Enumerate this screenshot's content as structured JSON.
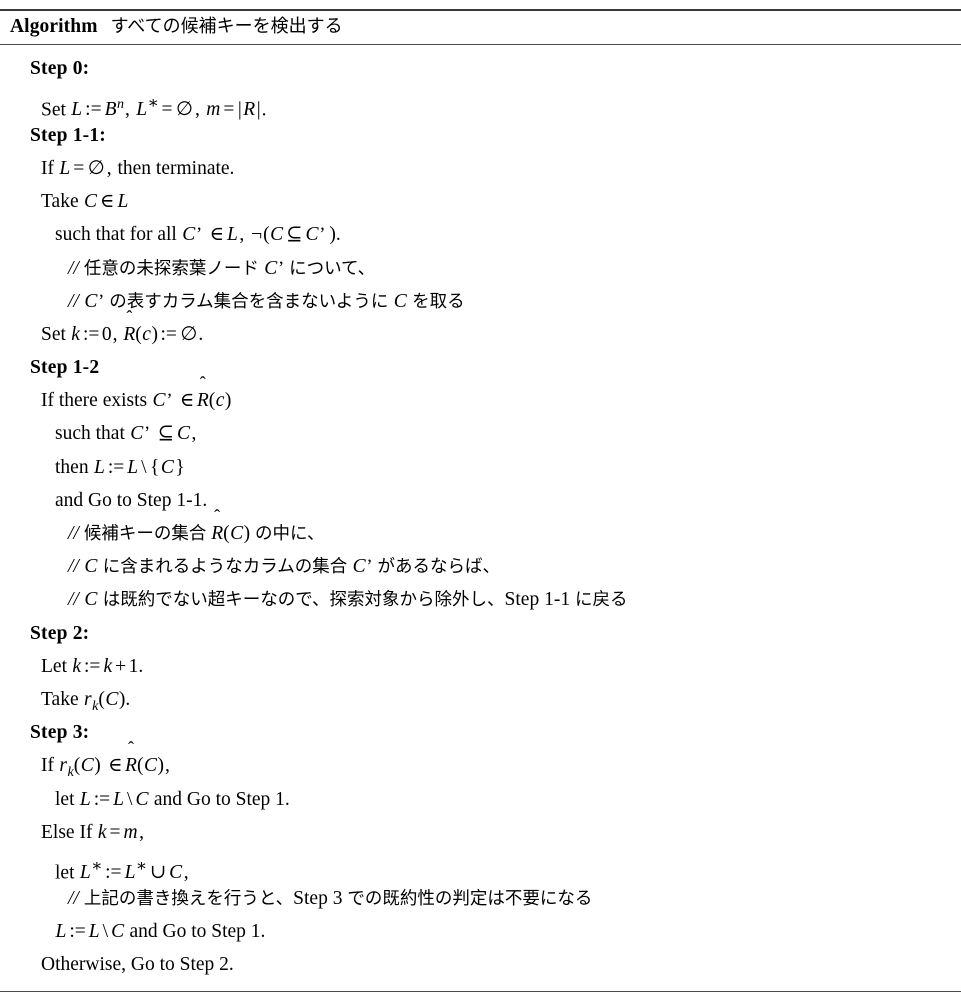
{
  "algorithm": {
    "caption_keyword": "Algorithm",
    "caption_title": "すべての候補キーを検出する",
    "steps": [
      {
        "heading": "Step 0:",
        "lines": [
          {
            "indent": 1,
            "kind": "math",
            "text": "Set L := Bⁿ, L* = ∅, m = |R|."
          }
        ]
      },
      {
        "heading": "Step 1-1:",
        "lines": [
          {
            "indent": 1,
            "kind": "math",
            "text": "If L = ∅, then terminate."
          },
          {
            "indent": 1,
            "kind": "math",
            "text": "Take C ∈ L"
          },
          {
            "indent": 2,
            "kind": "math",
            "text": "such that for all C’ ∈ L, ¬(C ⊆ C’)."
          },
          {
            "indent": 3,
            "kind": "comment",
            "text": "// 任意の未探索葉ノード C’ について、"
          },
          {
            "indent": 3,
            "kind": "comment",
            "text": "// C’ の表すカラム集合を含まないように C を取る"
          },
          {
            "indent": 1,
            "kind": "math",
            "text": "Set k := 0, R̂(c) := ∅."
          }
        ]
      },
      {
        "heading": "Step 1-2",
        "lines": [
          {
            "indent": 1,
            "kind": "math",
            "text": "If there exists C’ ∈ R̂(c)"
          },
          {
            "indent": 2,
            "kind": "math",
            "text": "such that C’ ⊆ C,"
          },
          {
            "indent": 2,
            "kind": "math",
            "text": "then L := L \\ {C}"
          },
          {
            "indent": 2,
            "kind": "math",
            "text": "and Go to Step 1-1."
          },
          {
            "indent": 3,
            "kind": "comment",
            "text": "// 候補キーの集合 R̂(C) の中に、"
          },
          {
            "indent": 3,
            "kind": "comment",
            "text": "// C に含まれるようなカラムの集合 C’ があるならば、"
          },
          {
            "indent": 3,
            "kind": "comment",
            "text": "// C は既約でない超キーなので、探索対象から除外し、Step 1-1 に戻る"
          }
        ]
      },
      {
        "heading": "Step 2:",
        "lines": [
          {
            "indent": 1,
            "kind": "math",
            "text": "Let k := k + 1."
          },
          {
            "indent": 1,
            "kind": "math",
            "text": "Take rₖ(C)."
          }
        ]
      },
      {
        "heading": "Step 3:",
        "lines": [
          {
            "indent": 1,
            "kind": "math",
            "text": "If rₖ(C) ∈ R̂(C),"
          },
          {
            "indent": 2,
            "kind": "math",
            "text": "let L := L \\ C and Go to Step 1."
          },
          {
            "indent": 1,
            "kind": "math",
            "text": "Else If k = m,"
          },
          {
            "indent": 2,
            "kind": "math",
            "text": "let L* := L* ∪ C,"
          },
          {
            "indent": 3,
            "kind": "comment",
            "text": "// 上記の書き換えを行うと、Step 3 での既約性の判定は不要になる"
          },
          {
            "indent": 2,
            "kind": "math",
            "text": "L := L \\ C and Go to Step 1."
          },
          {
            "indent": 1,
            "kind": "math",
            "text": "Otherwise, Go to Step 2."
          }
        ]
      }
    ]
  }
}
